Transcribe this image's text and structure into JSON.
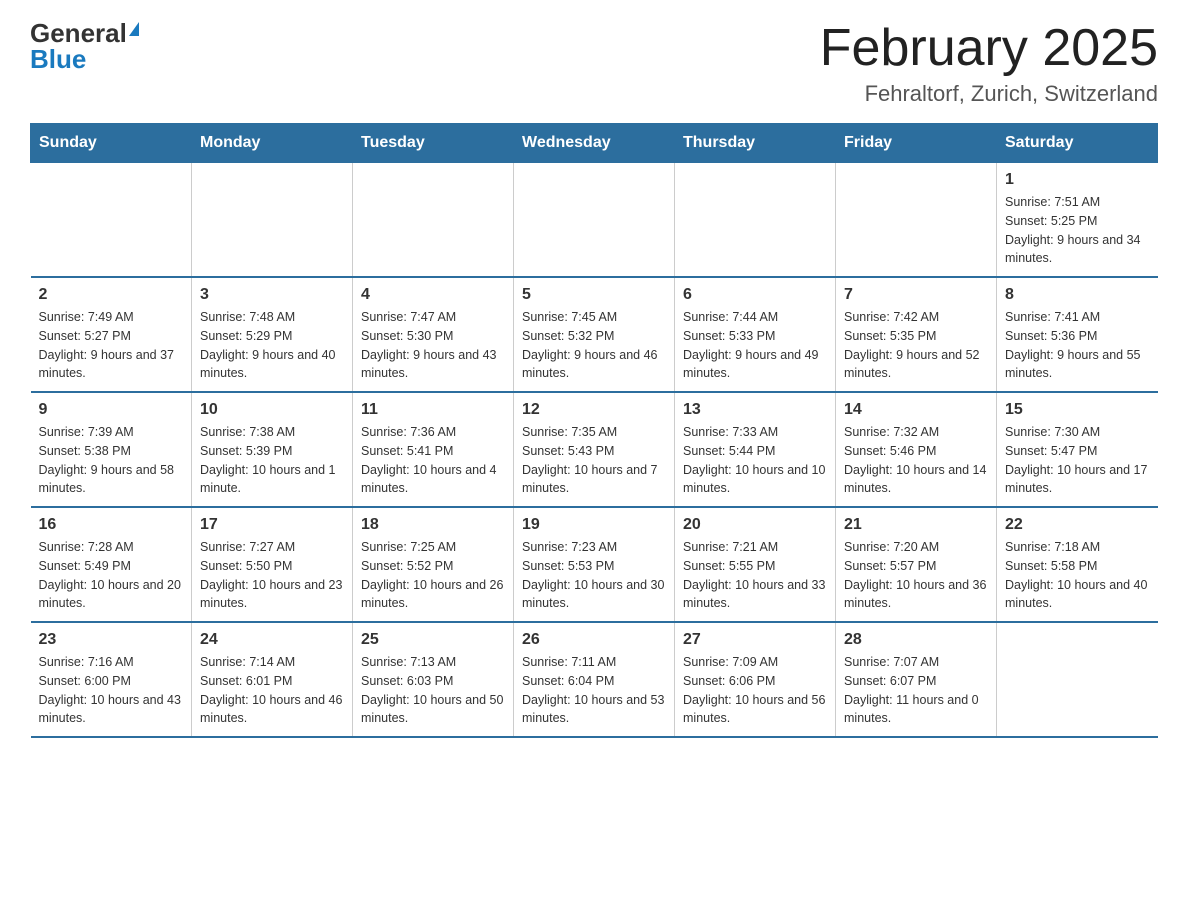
{
  "logo": {
    "general": "General",
    "blue": "Blue"
  },
  "header": {
    "month": "February 2025",
    "location": "Fehraltorf, Zurich, Switzerland"
  },
  "days_of_week": [
    "Sunday",
    "Monday",
    "Tuesday",
    "Wednesday",
    "Thursday",
    "Friday",
    "Saturday"
  ],
  "weeks": [
    [
      {
        "day": "",
        "info": ""
      },
      {
        "day": "",
        "info": ""
      },
      {
        "day": "",
        "info": ""
      },
      {
        "day": "",
        "info": ""
      },
      {
        "day": "",
        "info": ""
      },
      {
        "day": "",
        "info": ""
      },
      {
        "day": "1",
        "info": "Sunrise: 7:51 AM\nSunset: 5:25 PM\nDaylight: 9 hours and 34 minutes."
      }
    ],
    [
      {
        "day": "2",
        "info": "Sunrise: 7:49 AM\nSunset: 5:27 PM\nDaylight: 9 hours and 37 minutes."
      },
      {
        "day": "3",
        "info": "Sunrise: 7:48 AM\nSunset: 5:29 PM\nDaylight: 9 hours and 40 minutes."
      },
      {
        "day": "4",
        "info": "Sunrise: 7:47 AM\nSunset: 5:30 PM\nDaylight: 9 hours and 43 minutes."
      },
      {
        "day": "5",
        "info": "Sunrise: 7:45 AM\nSunset: 5:32 PM\nDaylight: 9 hours and 46 minutes."
      },
      {
        "day": "6",
        "info": "Sunrise: 7:44 AM\nSunset: 5:33 PM\nDaylight: 9 hours and 49 minutes."
      },
      {
        "day": "7",
        "info": "Sunrise: 7:42 AM\nSunset: 5:35 PM\nDaylight: 9 hours and 52 minutes."
      },
      {
        "day": "8",
        "info": "Sunrise: 7:41 AM\nSunset: 5:36 PM\nDaylight: 9 hours and 55 minutes."
      }
    ],
    [
      {
        "day": "9",
        "info": "Sunrise: 7:39 AM\nSunset: 5:38 PM\nDaylight: 9 hours and 58 minutes."
      },
      {
        "day": "10",
        "info": "Sunrise: 7:38 AM\nSunset: 5:39 PM\nDaylight: 10 hours and 1 minute."
      },
      {
        "day": "11",
        "info": "Sunrise: 7:36 AM\nSunset: 5:41 PM\nDaylight: 10 hours and 4 minutes."
      },
      {
        "day": "12",
        "info": "Sunrise: 7:35 AM\nSunset: 5:43 PM\nDaylight: 10 hours and 7 minutes."
      },
      {
        "day": "13",
        "info": "Sunrise: 7:33 AM\nSunset: 5:44 PM\nDaylight: 10 hours and 10 minutes."
      },
      {
        "day": "14",
        "info": "Sunrise: 7:32 AM\nSunset: 5:46 PM\nDaylight: 10 hours and 14 minutes."
      },
      {
        "day": "15",
        "info": "Sunrise: 7:30 AM\nSunset: 5:47 PM\nDaylight: 10 hours and 17 minutes."
      }
    ],
    [
      {
        "day": "16",
        "info": "Sunrise: 7:28 AM\nSunset: 5:49 PM\nDaylight: 10 hours and 20 minutes."
      },
      {
        "day": "17",
        "info": "Sunrise: 7:27 AM\nSunset: 5:50 PM\nDaylight: 10 hours and 23 minutes."
      },
      {
        "day": "18",
        "info": "Sunrise: 7:25 AM\nSunset: 5:52 PM\nDaylight: 10 hours and 26 minutes."
      },
      {
        "day": "19",
        "info": "Sunrise: 7:23 AM\nSunset: 5:53 PM\nDaylight: 10 hours and 30 minutes."
      },
      {
        "day": "20",
        "info": "Sunrise: 7:21 AM\nSunset: 5:55 PM\nDaylight: 10 hours and 33 minutes."
      },
      {
        "day": "21",
        "info": "Sunrise: 7:20 AM\nSunset: 5:57 PM\nDaylight: 10 hours and 36 minutes."
      },
      {
        "day": "22",
        "info": "Sunrise: 7:18 AM\nSunset: 5:58 PM\nDaylight: 10 hours and 40 minutes."
      }
    ],
    [
      {
        "day": "23",
        "info": "Sunrise: 7:16 AM\nSunset: 6:00 PM\nDaylight: 10 hours and 43 minutes."
      },
      {
        "day": "24",
        "info": "Sunrise: 7:14 AM\nSunset: 6:01 PM\nDaylight: 10 hours and 46 minutes."
      },
      {
        "day": "25",
        "info": "Sunrise: 7:13 AM\nSunset: 6:03 PM\nDaylight: 10 hours and 50 minutes."
      },
      {
        "day": "26",
        "info": "Sunrise: 7:11 AM\nSunset: 6:04 PM\nDaylight: 10 hours and 53 minutes."
      },
      {
        "day": "27",
        "info": "Sunrise: 7:09 AM\nSunset: 6:06 PM\nDaylight: 10 hours and 56 minutes."
      },
      {
        "day": "28",
        "info": "Sunrise: 7:07 AM\nSunset: 6:07 PM\nDaylight: 11 hours and 0 minutes."
      },
      {
        "day": "",
        "info": ""
      }
    ]
  ]
}
